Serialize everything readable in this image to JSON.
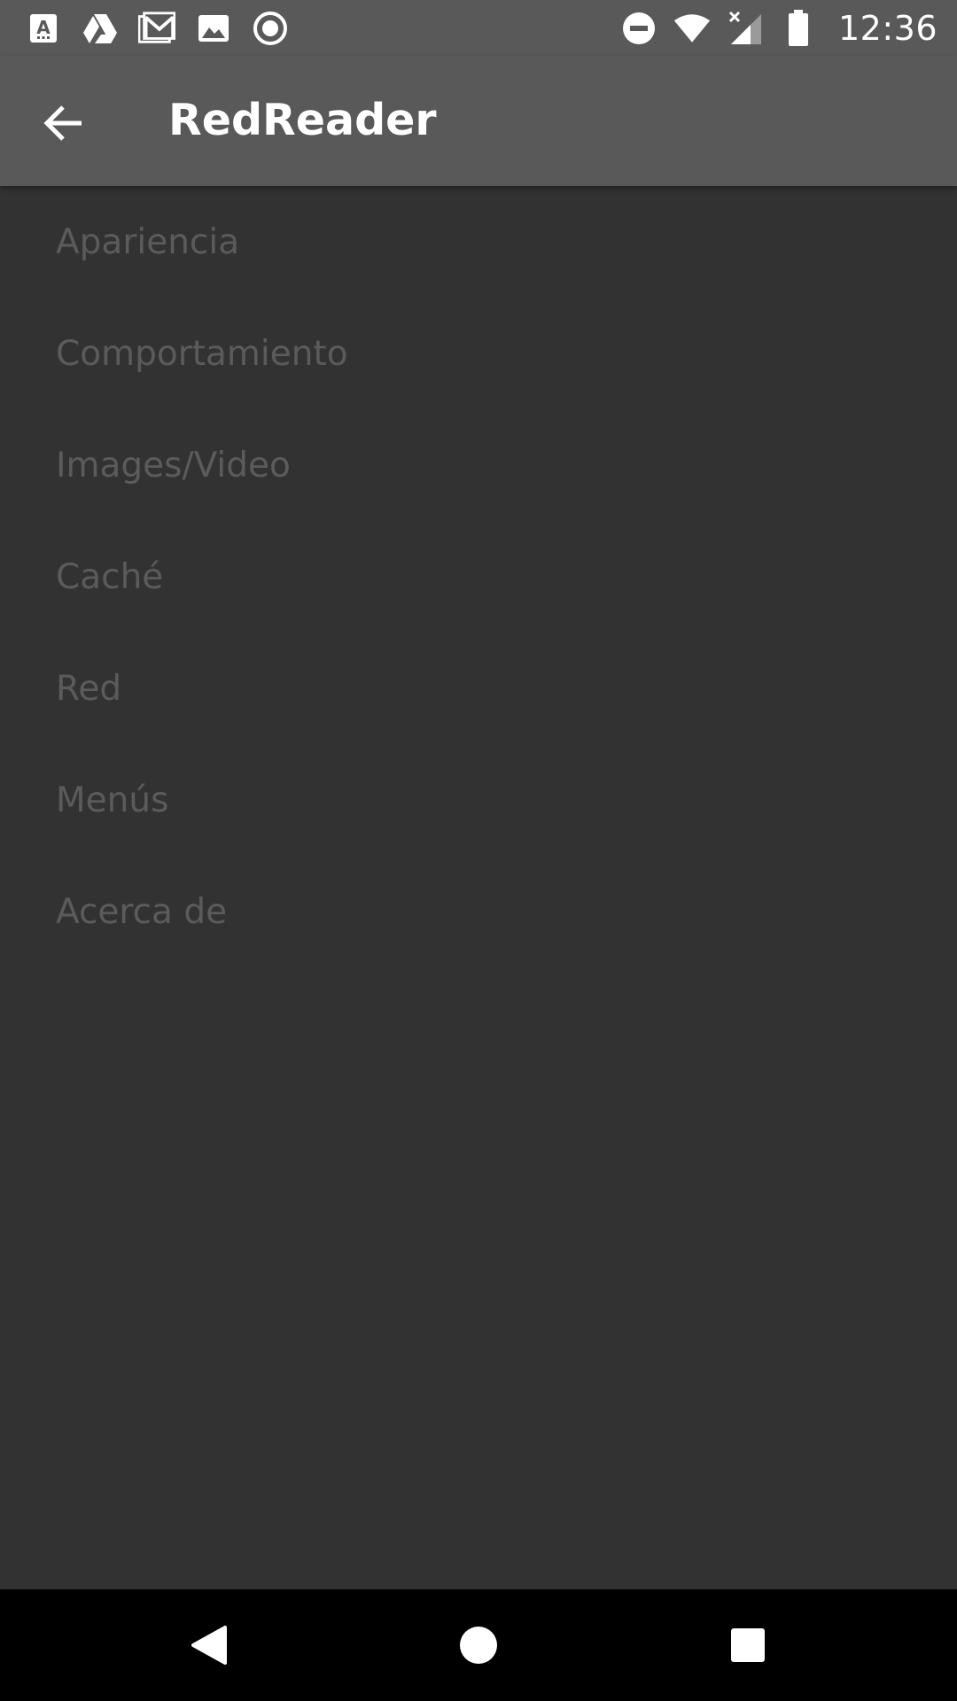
{
  "status_bar": {
    "time": "12:36",
    "left_icons": [
      "font-a-icon",
      "drive-icon",
      "gmail-icon",
      "image-icon",
      "record-icon"
    ],
    "right_icons": [
      "do-not-disturb-icon",
      "wifi-icon",
      "signal-icon",
      "battery-icon"
    ]
  },
  "app_bar": {
    "title": "RedReader",
    "back_icon": "arrow-back-icon"
  },
  "settings": {
    "items": [
      {
        "label": "Apariencia"
      },
      {
        "label": "Comportamiento"
      },
      {
        "label": "Images/Video"
      },
      {
        "label": "Caché"
      },
      {
        "label": "Red"
      },
      {
        "label": "Menús"
      },
      {
        "label": "Acerca de"
      }
    ]
  },
  "nav_bar": {
    "icons": [
      "nav-back-icon",
      "nav-home-icon",
      "nav-recents-icon"
    ]
  },
  "colors": {
    "status_bar": "#595959",
    "app_bar": "#595959",
    "background": "#323232",
    "item_text": "#5b5b5b",
    "nav_bar": "#000000"
  }
}
